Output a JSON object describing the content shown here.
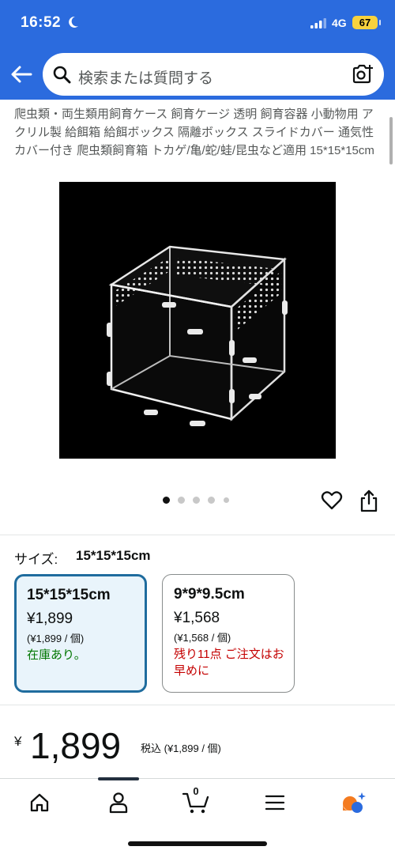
{
  "status_bar": {
    "time": "16:52",
    "network": "4G",
    "battery": "67"
  },
  "search": {
    "placeholder": "検索または質問する"
  },
  "product": {
    "title": "爬虫類・両生類用飼育ケース 飼育ケージ 透明 飼育容器 小動物用 アクリル製 給餌箱 給餌ボックス 隔離ボックス スライドカバー 通気性 カバー付き 爬虫類飼育箱 トカゲ/亀/蛇/蛙/昆虫など適用 15*15*15cm",
    "image_icon": "acrylic-terrarium-cube",
    "carousel": {
      "count": 5,
      "active": 1
    }
  },
  "size_selector": {
    "label": "サイズ:",
    "selected": "15*15*15cm",
    "options": [
      {
        "name": "15*15*15cm",
        "price": "¥1,899",
        "unit_price": "(¥1,899 / 個)",
        "stock": "在庫あり。",
        "selected": true
      },
      {
        "name": "9*9*9.5cm",
        "price": "¥1,568",
        "unit_price": "(¥1,568 / 個)",
        "stock": "残り11点 ご注文はお早めに",
        "selected": false
      }
    ]
  },
  "price": {
    "symbol": "¥",
    "amount": "1,899",
    "tax_note": "税込 (¥1,899 / 個)"
  },
  "bottom_nav": {
    "items": [
      "home-icon",
      "account-icon",
      "cart-icon",
      "menu-icon",
      "rufus-ai-icon"
    ],
    "cart_count": "0"
  },
  "colors": {
    "header": "#2b6bde",
    "selected_border": "#1f6c9e",
    "in_stock": "#007600",
    "low_stock": "#c40000",
    "battery": "#f7d23e"
  }
}
